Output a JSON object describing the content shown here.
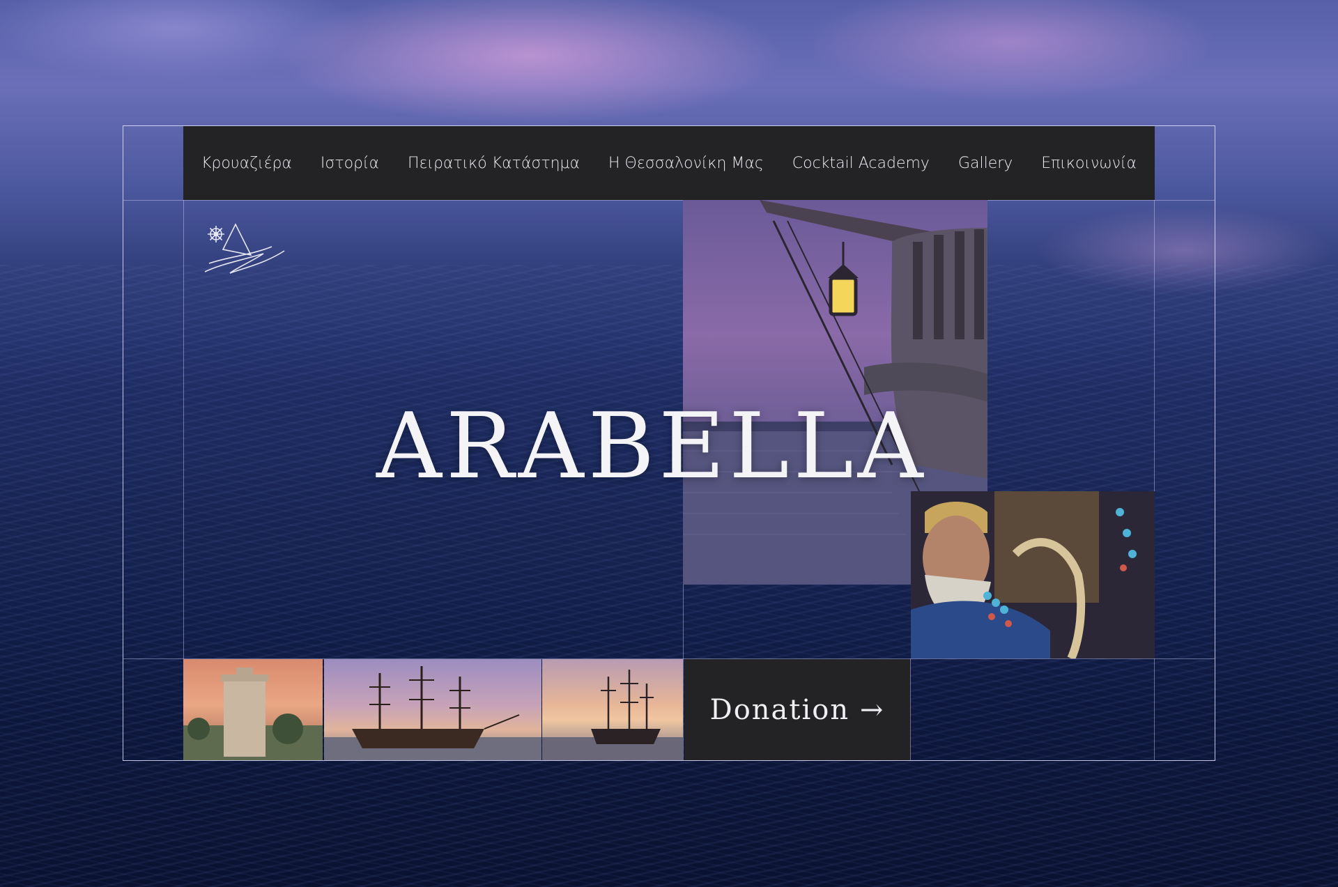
{
  "nav": {
    "items": [
      {
        "label": "Κρουαζιέρα"
      },
      {
        "label": "Ιστορία"
      },
      {
        "label": "Πειρατικό Κατάστημα"
      },
      {
        "label": "Η Θεσσαλονίκη Μας"
      },
      {
        "label": "Cocktail Academy"
      },
      {
        "label": "Gallery"
      },
      {
        "label": "Επικοινωνία"
      }
    ]
  },
  "hero": {
    "title": "ARABELLA"
  },
  "cta": {
    "donation_label": "Donation →"
  },
  "colors": {
    "nav_bg": "#232325",
    "text_light": "#ecedf2",
    "frame_line": "#e1e1ff"
  },
  "icons": [
    "ship-wheel-logo-icon"
  ]
}
